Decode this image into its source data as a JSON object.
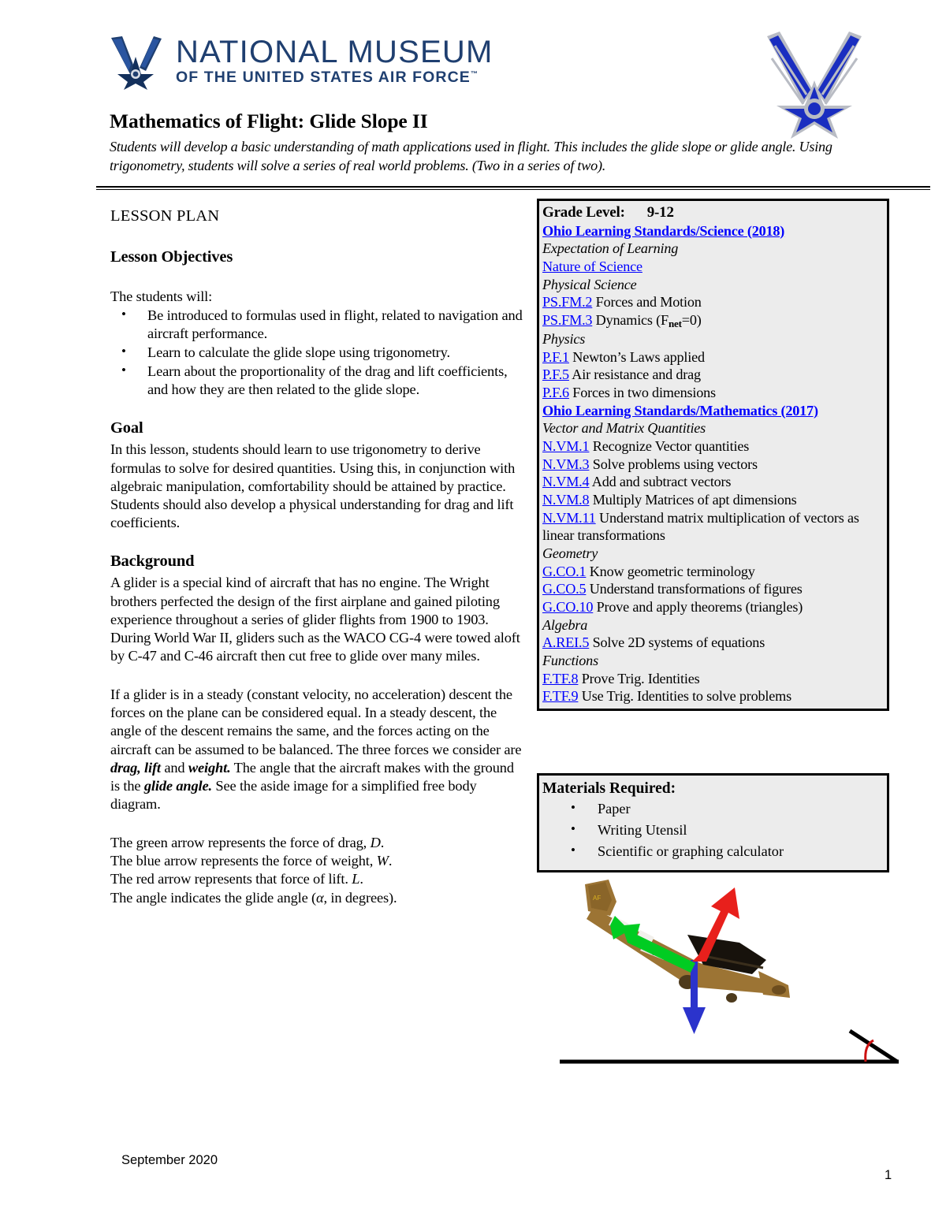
{
  "header": {
    "logo_line1": "NATIONAL MUSEUM",
    "logo_line2": "OF THE UNITED STATES AIR FORCE",
    "logo_tm": "™",
    "wing_icon": "air-force-wings-icon",
    "emblem_icon": "air-force-winged-star-emblem"
  },
  "title": {
    "heading": "Mathematics of Flight: Glide Slope II",
    "subtitle": "Students will develop a basic understanding of math applications used in flight. This includes the glide slope or glide angle. Using trigonometry, students will solve a series of real world problems. (Two in a series of two)."
  },
  "left": {
    "lesson_plan_label": "LESSON PLAN",
    "objectives_heading": "Lesson Objectives",
    "objectives_lead": "The students will:",
    "objectives": [
      "Be introduced to formulas used in flight, related to navigation and aircraft performance.",
      "Learn to calculate the glide slope using trigonometry.",
      "Learn about the proportionality of the drag and lift coefficients, and how they are then related to the glide slope."
    ],
    "goal_heading": "Goal",
    "goal_text": "In this lesson, students should learn to use trigonometry to derive formulas to solve for desired quantities. Using this, in conjunction with algebraic manipulation, comfortability should be attained by practice. Students should also develop a physical understanding for drag and lift coefficients.",
    "background_heading": "Background",
    "background_p1": "A glider is a special kind of aircraft that has no engine. The Wright brothers perfected the design of the first airplane and gained piloting experience throughout a series of glider flights from 1900 to 1903. During World War II, gliders such as the WACO CG-4 were towed aloft by C-47 and C-46 aircraft then cut free to glide over many miles.",
    "background_p2_part1": "If a glider is in a steady (constant velocity, no acceleration) descent the forces on the plane can be considered equal. In a steady descent, the angle of the descent remains the same, and the forces acting on the aircraft can be assumed to be balanced. The three forces we consider are ",
    "background_p2_bold1": "drag, lift",
    "background_p2_part2": " and ",
    "background_p2_bold2": "weight.",
    "background_p2_part3": " The angle that the aircraft makes with the ground is the ",
    "background_p2_bold3": "glide angle.",
    "background_p2_part4": " See the aside image for a simplified free body diagram.",
    "arrows": [
      {
        "text_before": "The green arrow represents the force of drag, ",
        "symbol": "D",
        "text_after": "."
      },
      {
        "text_before": "The blue arrow represents the force of weight, ",
        "symbol": "W",
        "text_after": "."
      },
      {
        "text_before": "The red arrow represents that force of lift. ",
        "symbol": "L",
        "text_after": "."
      },
      {
        "text_before": "The angle indicates the glide angle (",
        "symbol": "α",
        "text_after": ", in degrees)."
      }
    ]
  },
  "standards": {
    "grade_label": "Grade Level:",
    "grade_value": "9-12",
    "science_link": "Ohio Learning Standards/Science (2018)",
    "expectation_of_learning": "Expectation of Learning",
    "nature_of_science": "Nature of Science ",
    "physical_science_label": "Physical Science",
    "ps_items": [
      {
        "code": "PS.FM.2",
        "desc": " Forces and Motion",
        "sub": ""
      },
      {
        "code": "PS.FM.3",
        "desc": " Dynamics (F",
        "sub": "net",
        "desc2": "=0)"
      }
    ],
    "physics_label": "Physics",
    "pf_items": [
      {
        "code": "P.F.1",
        "desc": " Newton’s Laws applied"
      },
      {
        "code": "P.F.5",
        "desc": " Air resistance and drag"
      },
      {
        "code": "P.F.6",
        "desc": " Forces in two dimensions"
      }
    ],
    "math_link": "Ohio Learning Standards/Mathematics (2017)",
    "vector_label": "Vector and Matrix Quantities",
    "vm_items": [
      {
        "code": "N.VM.1",
        "desc": " Recognize Vector quantities"
      },
      {
        "code": "N.VM.3",
        "desc": " Solve problems using vectors"
      },
      {
        "code": "N.VM.4",
        "desc": " Add and subtract vectors"
      },
      {
        "code": "N.VM.8",
        "desc": " Multiply Matrices of apt dimensions"
      },
      {
        "code": "N.VM.11",
        "desc": " Understand matrix multiplication of vectors as linear transformations"
      }
    ],
    "geometry_label": "Geometry",
    "geo_items": [
      {
        "code": "G.CO.1",
        "desc": " Know geometric terminology"
      },
      {
        "code": "G.CO.5",
        "desc": " Understand transformations of figures"
      },
      {
        "code": "G.CO.10",
        "desc": " Prove and apply theorems (triangles)"
      }
    ],
    "algebra_label": "Algebra",
    "alg_items": [
      {
        "code": "A.REI.5",
        "desc": " Solve 2D systems of equations"
      }
    ],
    "functions_label": "Functions",
    "fn_items": [
      {
        "code": "F.TF.8",
        "desc": " Prove Trig. Identities"
      },
      {
        "code": "F.TF.9",
        "desc": " Use Trig. Identities to solve problems"
      }
    ]
  },
  "materials": {
    "heading": "Materials Required:",
    "items": [
      "Paper",
      "Writing Utensil",
      "Scientific or graphing calculator"
    ]
  },
  "diagram": {
    "name": "glider-free-body-diagram",
    "lift_arrow_color": "#e8201c",
    "drag_arrow_color": "#00cc22",
    "weight_arrow_color": "#2b33cc",
    "glider_color": "#9c7434",
    "angle_arc_color": "#cc1111"
  },
  "footer": {
    "date": "September 2020",
    "page_number": "1"
  },
  "colors": {
    "link_blue": "#0000ff",
    "brand_navy": "#1f3f70",
    "box_gray": "#ececec"
  }
}
